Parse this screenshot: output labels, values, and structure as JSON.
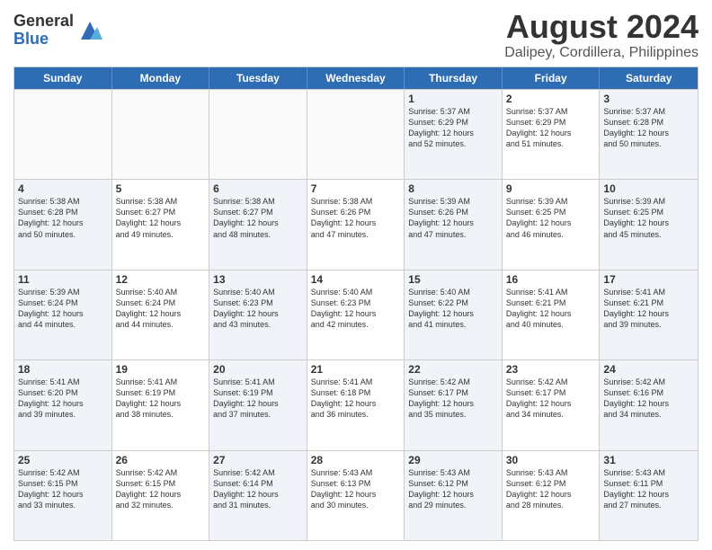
{
  "logo": {
    "general": "General",
    "blue": "Blue"
  },
  "title": "August 2024",
  "subtitle": "Dalipey, Cordillera, Philippines",
  "days": [
    "Sunday",
    "Monday",
    "Tuesday",
    "Wednesday",
    "Thursday",
    "Friday",
    "Saturday"
  ],
  "weeks": [
    [
      {
        "day": "",
        "info": ""
      },
      {
        "day": "",
        "info": ""
      },
      {
        "day": "",
        "info": ""
      },
      {
        "day": "",
        "info": ""
      },
      {
        "day": "1",
        "info": "Sunrise: 5:37 AM\nSunset: 6:29 PM\nDaylight: 12 hours\nand 52 minutes."
      },
      {
        "day": "2",
        "info": "Sunrise: 5:37 AM\nSunset: 6:29 PM\nDaylight: 12 hours\nand 51 minutes."
      },
      {
        "day": "3",
        "info": "Sunrise: 5:37 AM\nSunset: 6:28 PM\nDaylight: 12 hours\nand 50 minutes."
      }
    ],
    [
      {
        "day": "4",
        "info": "Sunrise: 5:38 AM\nSunset: 6:28 PM\nDaylight: 12 hours\nand 50 minutes."
      },
      {
        "day": "5",
        "info": "Sunrise: 5:38 AM\nSunset: 6:27 PM\nDaylight: 12 hours\nand 49 minutes."
      },
      {
        "day": "6",
        "info": "Sunrise: 5:38 AM\nSunset: 6:27 PM\nDaylight: 12 hours\nand 48 minutes."
      },
      {
        "day": "7",
        "info": "Sunrise: 5:38 AM\nSunset: 6:26 PM\nDaylight: 12 hours\nand 47 minutes."
      },
      {
        "day": "8",
        "info": "Sunrise: 5:39 AM\nSunset: 6:26 PM\nDaylight: 12 hours\nand 47 minutes."
      },
      {
        "day": "9",
        "info": "Sunrise: 5:39 AM\nSunset: 6:25 PM\nDaylight: 12 hours\nand 46 minutes."
      },
      {
        "day": "10",
        "info": "Sunrise: 5:39 AM\nSunset: 6:25 PM\nDaylight: 12 hours\nand 45 minutes."
      }
    ],
    [
      {
        "day": "11",
        "info": "Sunrise: 5:39 AM\nSunset: 6:24 PM\nDaylight: 12 hours\nand 44 minutes."
      },
      {
        "day": "12",
        "info": "Sunrise: 5:40 AM\nSunset: 6:24 PM\nDaylight: 12 hours\nand 44 minutes."
      },
      {
        "day": "13",
        "info": "Sunrise: 5:40 AM\nSunset: 6:23 PM\nDaylight: 12 hours\nand 43 minutes."
      },
      {
        "day": "14",
        "info": "Sunrise: 5:40 AM\nSunset: 6:23 PM\nDaylight: 12 hours\nand 42 minutes."
      },
      {
        "day": "15",
        "info": "Sunrise: 5:40 AM\nSunset: 6:22 PM\nDaylight: 12 hours\nand 41 minutes."
      },
      {
        "day": "16",
        "info": "Sunrise: 5:41 AM\nSunset: 6:21 PM\nDaylight: 12 hours\nand 40 minutes."
      },
      {
        "day": "17",
        "info": "Sunrise: 5:41 AM\nSunset: 6:21 PM\nDaylight: 12 hours\nand 39 minutes."
      }
    ],
    [
      {
        "day": "18",
        "info": "Sunrise: 5:41 AM\nSunset: 6:20 PM\nDaylight: 12 hours\nand 39 minutes."
      },
      {
        "day": "19",
        "info": "Sunrise: 5:41 AM\nSunset: 6:19 PM\nDaylight: 12 hours\nand 38 minutes."
      },
      {
        "day": "20",
        "info": "Sunrise: 5:41 AM\nSunset: 6:19 PM\nDaylight: 12 hours\nand 37 minutes."
      },
      {
        "day": "21",
        "info": "Sunrise: 5:41 AM\nSunset: 6:18 PM\nDaylight: 12 hours\nand 36 minutes."
      },
      {
        "day": "22",
        "info": "Sunrise: 5:42 AM\nSunset: 6:17 PM\nDaylight: 12 hours\nand 35 minutes."
      },
      {
        "day": "23",
        "info": "Sunrise: 5:42 AM\nSunset: 6:17 PM\nDaylight: 12 hours\nand 34 minutes."
      },
      {
        "day": "24",
        "info": "Sunrise: 5:42 AM\nSunset: 6:16 PM\nDaylight: 12 hours\nand 34 minutes."
      }
    ],
    [
      {
        "day": "25",
        "info": "Sunrise: 5:42 AM\nSunset: 6:15 PM\nDaylight: 12 hours\nand 33 minutes."
      },
      {
        "day": "26",
        "info": "Sunrise: 5:42 AM\nSunset: 6:15 PM\nDaylight: 12 hours\nand 32 minutes."
      },
      {
        "day": "27",
        "info": "Sunrise: 5:42 AM\nSunset: 6:14 PM\nDaylight: 12 hours\nand 31 minutes."
      },
      {
        "day": "28",
        "info": "Sunrise: 5:43 AM\nSunset: 6:13 PM\nDaylight: 12 hours\nand 30 minutes."
      },
      {
        "day": "29",
        "info": "Sunrise: 5:43 AM\nSunset: 6:12 PM\nDaylight: 12 hours\nand 29 minutes."
      },
      {
        "day": "30",
        "info": "Sunrise: 5:43 AM\nSunset: 6:12 PM\nDaylight: 12 hours\nand 28 minutes."
      },
      {
        "day": "31",
        "info": "Sunrise: 5:43 AM\nSunset: 6:11 PM\nDaylight: 12 hours\nand 27 minutes."
      }
    ]
  ]
}
